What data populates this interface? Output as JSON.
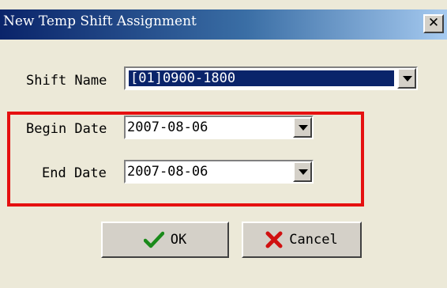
{
  "window": {
    "title": "New Temp Shift Assignment",
    "close_glyph": "✕"
  },
  "form": {
    "shift_name": {
      "label": "Shift Name",
      "value": "[01]0900-1800"
    },
    "begin_date": {
      "label": "Begin Date",
      "value": "2007-08-06"
    },
    "end_date": {
      "label": "End Date",
      "value": "2007-08-06"
    }
  },
  "buttons": {
    "ok": {
      "label": "OK",
      "icon": "checkmark-icon",
      "icon_color": "#1a8a1a"
    },
    "cancel": {
      "label": "Cancel",
      "icon": "x-icon",
      "icon_color": "#d01010"
    }
  },
  "colors": {
    "highlight_box": "#e51010",
    "selection": "#0a246a"
  }
}
